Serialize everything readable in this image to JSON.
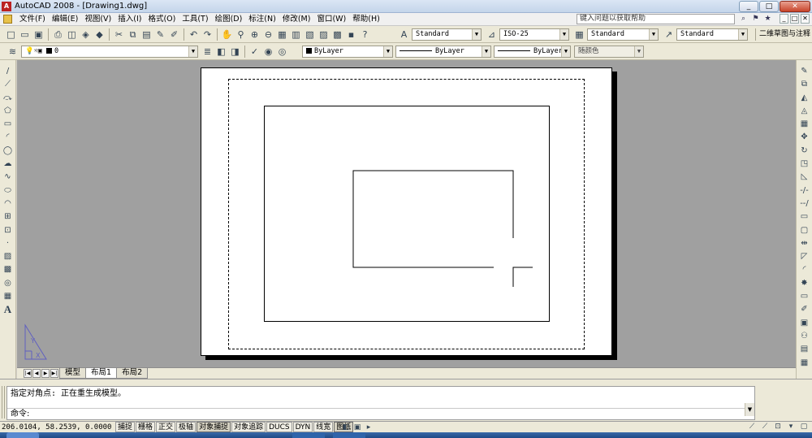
{
  "window": {
    "title": "AutoCAD 2008 - [Drawing1.dwg]",
    "buttons": [
      "_",
      "□",
      "✕"
    ]
  },
  "menubar": {
    "items": [
      "文件(F)",
      "编辑(E)",
      "视图(V)",
      "插入(I)",
      "格式(O)",
      "工具(T)",
      "绘图(D)",
      "标注(N)",
      "修改(M)",
      "窗口(W)",
      "帮助(H)"
    ],
    "help_placeholder": "键入问题以获取帮助",
    "mdi_buttons": [
      "_",
      "□",
      "✕"
    ]
  },
  "toolbar1": {
    "text_style": "Standard",
    "dim_style": "ISO-25",
    "table_style": "Standard",
    "mleader_style": "Standard",
    "workspace": "二维草图与注释"
  },
  "toolbar2": {
    "layer": "0",
    "color": "ByLayer",
    "linetype": "ByLayer",
    "lineweight": "ByLayer",
    "plot_style": "随颜色"
  },
  "left_toolbar": {
    "icons": [
      "line-icon",
      "construction-line-icon",
      "polyline-icon",
      "polygon-icon",
      "rectangle-icon",
      "arc-icon",
      "circle-icon",
      "revision-cloud-icon",
      "spline-icon",
      "ellipse-icon",
      "ellipse-arc-icon",
      "insert-block-icon",
      "make-block-icon",
      "point-icon",
      "hatch-icon",
      "gradient-icon",
      "region-icon",
      "table-icon",
      "mtext-icon"
    ],
    "text_icon_label": "A"
  },
  "right_toolbar": {
    "icons": [
      "erase-icon",
      "copy-icon",
      "mirror-icon",
      "offset-icon",
      "array-icon",
      "move-icon",
      "rotate-icon",
      "scale-icon",
      "stretch-icon",
      "trim-icon",
      "extend-icon",
      "break-at-point-icon",
      "break-icon",
      "join-icon",
      "chamfer-icon",
      "fillet-icon",
      "explode-icon",
      "properties-icon",
      "design-center-icon",
      "tool-palettes-icon",
      "sheet-set-icon",
      "markup-icon",
      "calculator-icon"
    ]
  },
  "layout_tabs": {
    "tabs": [
      "模型",
      "布局1",
      "布局2"
    ],
    "active": "布局1"
  },
  "command": {
    "history": "指定对角点: 正在重生成模型。",
    "prompt": "命令:"
  },
  "status": {
    "coordinates": "206.0104, 58.2539, 0.0000",
    "toggles": [
      {
        "label": "捕捉",
        "on": false
      },
      {
        "label": "栅格",
        "on": false
      },
      {
        "label": "正交",
        "on": false
      },
      {
        "label": "极轴",
        "on": false
      },
      {
        "label": "对象捕捉",
        "on": true
      },
      {
        "label": "对象追踪",
        "on": false
      },
      {
        "label": "DUCS",
        "on": false
      },
      {
        "label": "DYN",
        "on": false
      },
      {
        "label": "线宽",
        "on": false
      },
      {
        "label": "图纸",
        "on": true
      }
    ]
  },
  "colors": {
    "canvas_bg": "#a0a0a0",
    "paper": "#ffffff",
    "ucs_icon": "#6060c0",
    "title_bar": "#c4d5ea"
  }
}
